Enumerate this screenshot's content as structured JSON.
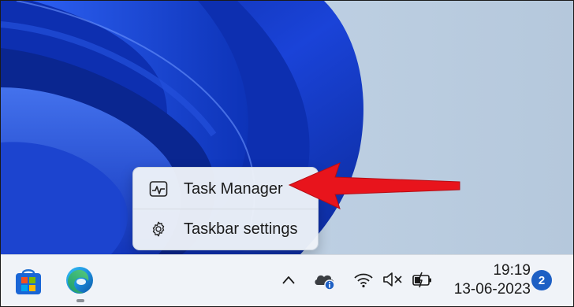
{
  "context_menu": {
    "items": [
      {
        "label": "Task Manager",
        "icon": "task-manager-icon"
      },
      {
        "label": "Taskbar settings",
        "icon": "gear-icon"
      }
    ]
  },
  "annotation": {
    "type": "arrow",
    "color": "#e8141c",
    "points_to": "Task Manager"
  },
  "taskbar": {
    "pinned_apps": [
      {
        "name": "Microsoft Store",
        "icon": "store-icon"
      },
      {
        "name": "Microsoft Edge",
        "icon": "edge-icon",
        "running": true
      }
    ],
    "tray": {
      "icons": [
        "chevron-up-icon",
        "onedrive-icon",
        "wifi-icon",
        "volume-muted-icon",
        "battery-charging-icon"
      ],
      "time": "19:19",
      "date": "13-06-2023",
      "notification_count": "2"
    }
  },
  "colors": {
    "wallpaper_blue": "#1436c8",
    "accent": "#1d5fc4",
    "taskbar_bg": "#f0f3f8"
  }
}
